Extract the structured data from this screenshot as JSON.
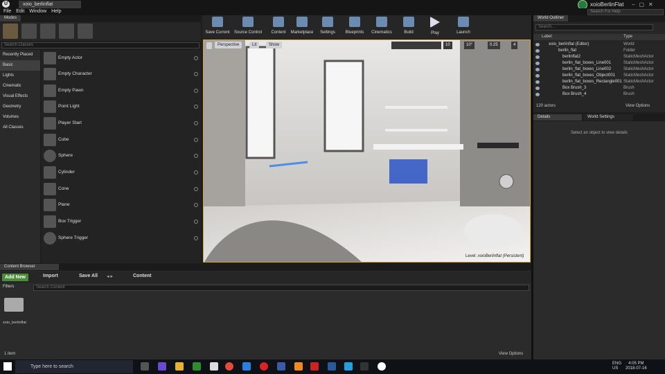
{
  "window": {
    "tab_title": "xoio_berlinflat",
    "project_name": "xoioBerlinFlat",
    "help_search_placeholder": "Search For Help"
  },
  "menu": [
    "File",
    "Edit",
    "Window",
    "Help"
  ],
  "modes": {
    "tab": "Modes",
    "search_placeholder": "Search Classes",
    "categories": [
      "Recently Placed",
      "Basic",
      "Lights",
      "Cinematic",
      "Visual Effects",
      "Geometry",
      "Volumes",
      "All Classes"
    ],
    "active_category": "Basic",
    "items": [
      "Empty Actor",
      "Empty Character",
      "Empty Pawn",
      "Point Light",
      "Player Start",
      "Cube",
      "Sphere",
      "Cylinder",
      "Cone",
      "Plane",
      "Box Trigger",
      "Sphere Trigger"
    ]
  },
  "toolbar": {
    "buttons": [
      "Save Current",
      "Source Control",
      "Content",
      "Marketplace",
      "Settings",
      "Blueprints",
      "Cinematics",
      "Build",
      "Play",
      "Launch"
    ]
  },
  "viewport": {
    "perspective": "Perspective",
    "lit": "Lit",
    "show": "Show",
    "grid_snap": "10",
    "rot_snap": "10°",
    "scale_snap": "0.25",
    "camera_speed": "4",
    "level_label": "Level:",
    "level_name": "xoioBerlinflat (Persistent)"
  },
  "outliner": {
    "tab": "World Outliner",
    "search_placeholder": "Search...",
    "col_label": "Label",
    "col_type": "Type",
    "rows": [
      {
        "name": "xoio_berlinflat (Editor)",
        "type": "World"
      },
      {
        "name": "berlin_flat",
        "type": "Folder"
      },
      {
        "name": "berlinflat2",
        "type": "StaticMeshActor"
      },
      {
        "name": "berlin_flat_boxes_Line001",
        "type": "StaticMeshActor"
      },
      {
        "name": "berlin_flat_boxes_Line002",
        "type": "StaticMeshActor"
      },
      {
        "name": "berlin_flat_boxes_Object001",
        "type": "StaticMeshActor"
      },
      {
        "name": "berlin_flat_boxes_Rectangle001",
        "type": "StaticMeshActor"
      },
      {
        "name": "Box Brush_3",
        "type": "Brush"
      },
      {
        "name": "Box Brush_4",
        "type": "Brush"
      }
    ],
    "actor_count": "120 actors",
    "view_options": "View Options"
  },
  "details": {
    "tab": "Details",
    "tab2": "World Settings",
    "empty_msg": "Select an object to view details"
  },
  "content_browser": {
    "tab": "Content Browser",
    "add_new": "Add New",
    "import": "Import",
    "save_all": "Save All",
    "path": "Content",
    "filters": "Filters",
    "search_placeholder": "Search Content",
    "folder_name": "xoio_berlinflat",
    "item_count": "1 item",
    "view_options": "View Options"
  },
  "taskbar": {
    "search_placeholder": "Type here to search",
    "lang": "ENG",
    "region": "US",
    "time": "4:05 PM",
    "date": "2018-07-16"
  }
}
